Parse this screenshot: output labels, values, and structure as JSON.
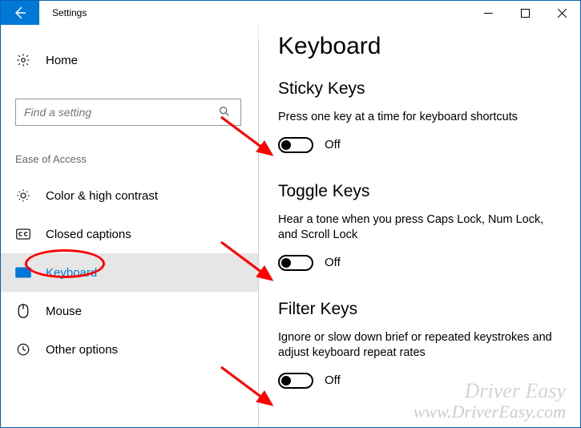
{
  "window": {
    "title": "Settings"
  },
  "sidebar": {
    "home_label": "Home",
    "search_placeholder": "Find a setting",
    "group_label": "Ease of Access",
    "items": [
      {
        "label": "Color & high contrast"
      },
      {
        "label": "Closed captions"
      },
      {
        "label": "Keyboard"
      },
      {
        "label": "Mouse"
      },
      {
        "label": "Other options"
      }
    ]
  },
  "page": {
    "title": "Keyboard",
    "sections": [
      {
        "heading": "Sticky Keys",
        "desc": "Press one key at a time for keyboard shortcuts",
        "state": "Off"
      },
      {
        "heading": "Toggle Keys",
        "desc": "Hear a tone when you press Caps Lock, Num Lock, and Scroll Lock",
        "state": "Off"
      },
      {
        "heading": "Filter Keys",
        "desc": "Ignore or slow down brief or repeated keystrokes and adjust keyboard repeat rates",
        "state": "Off"
      }
    ]
  },
  "annotations": {
    "watermark_top": "Driver Easy",
    "watermark_bottom": "www.DriverEasy.com"
  }
}
